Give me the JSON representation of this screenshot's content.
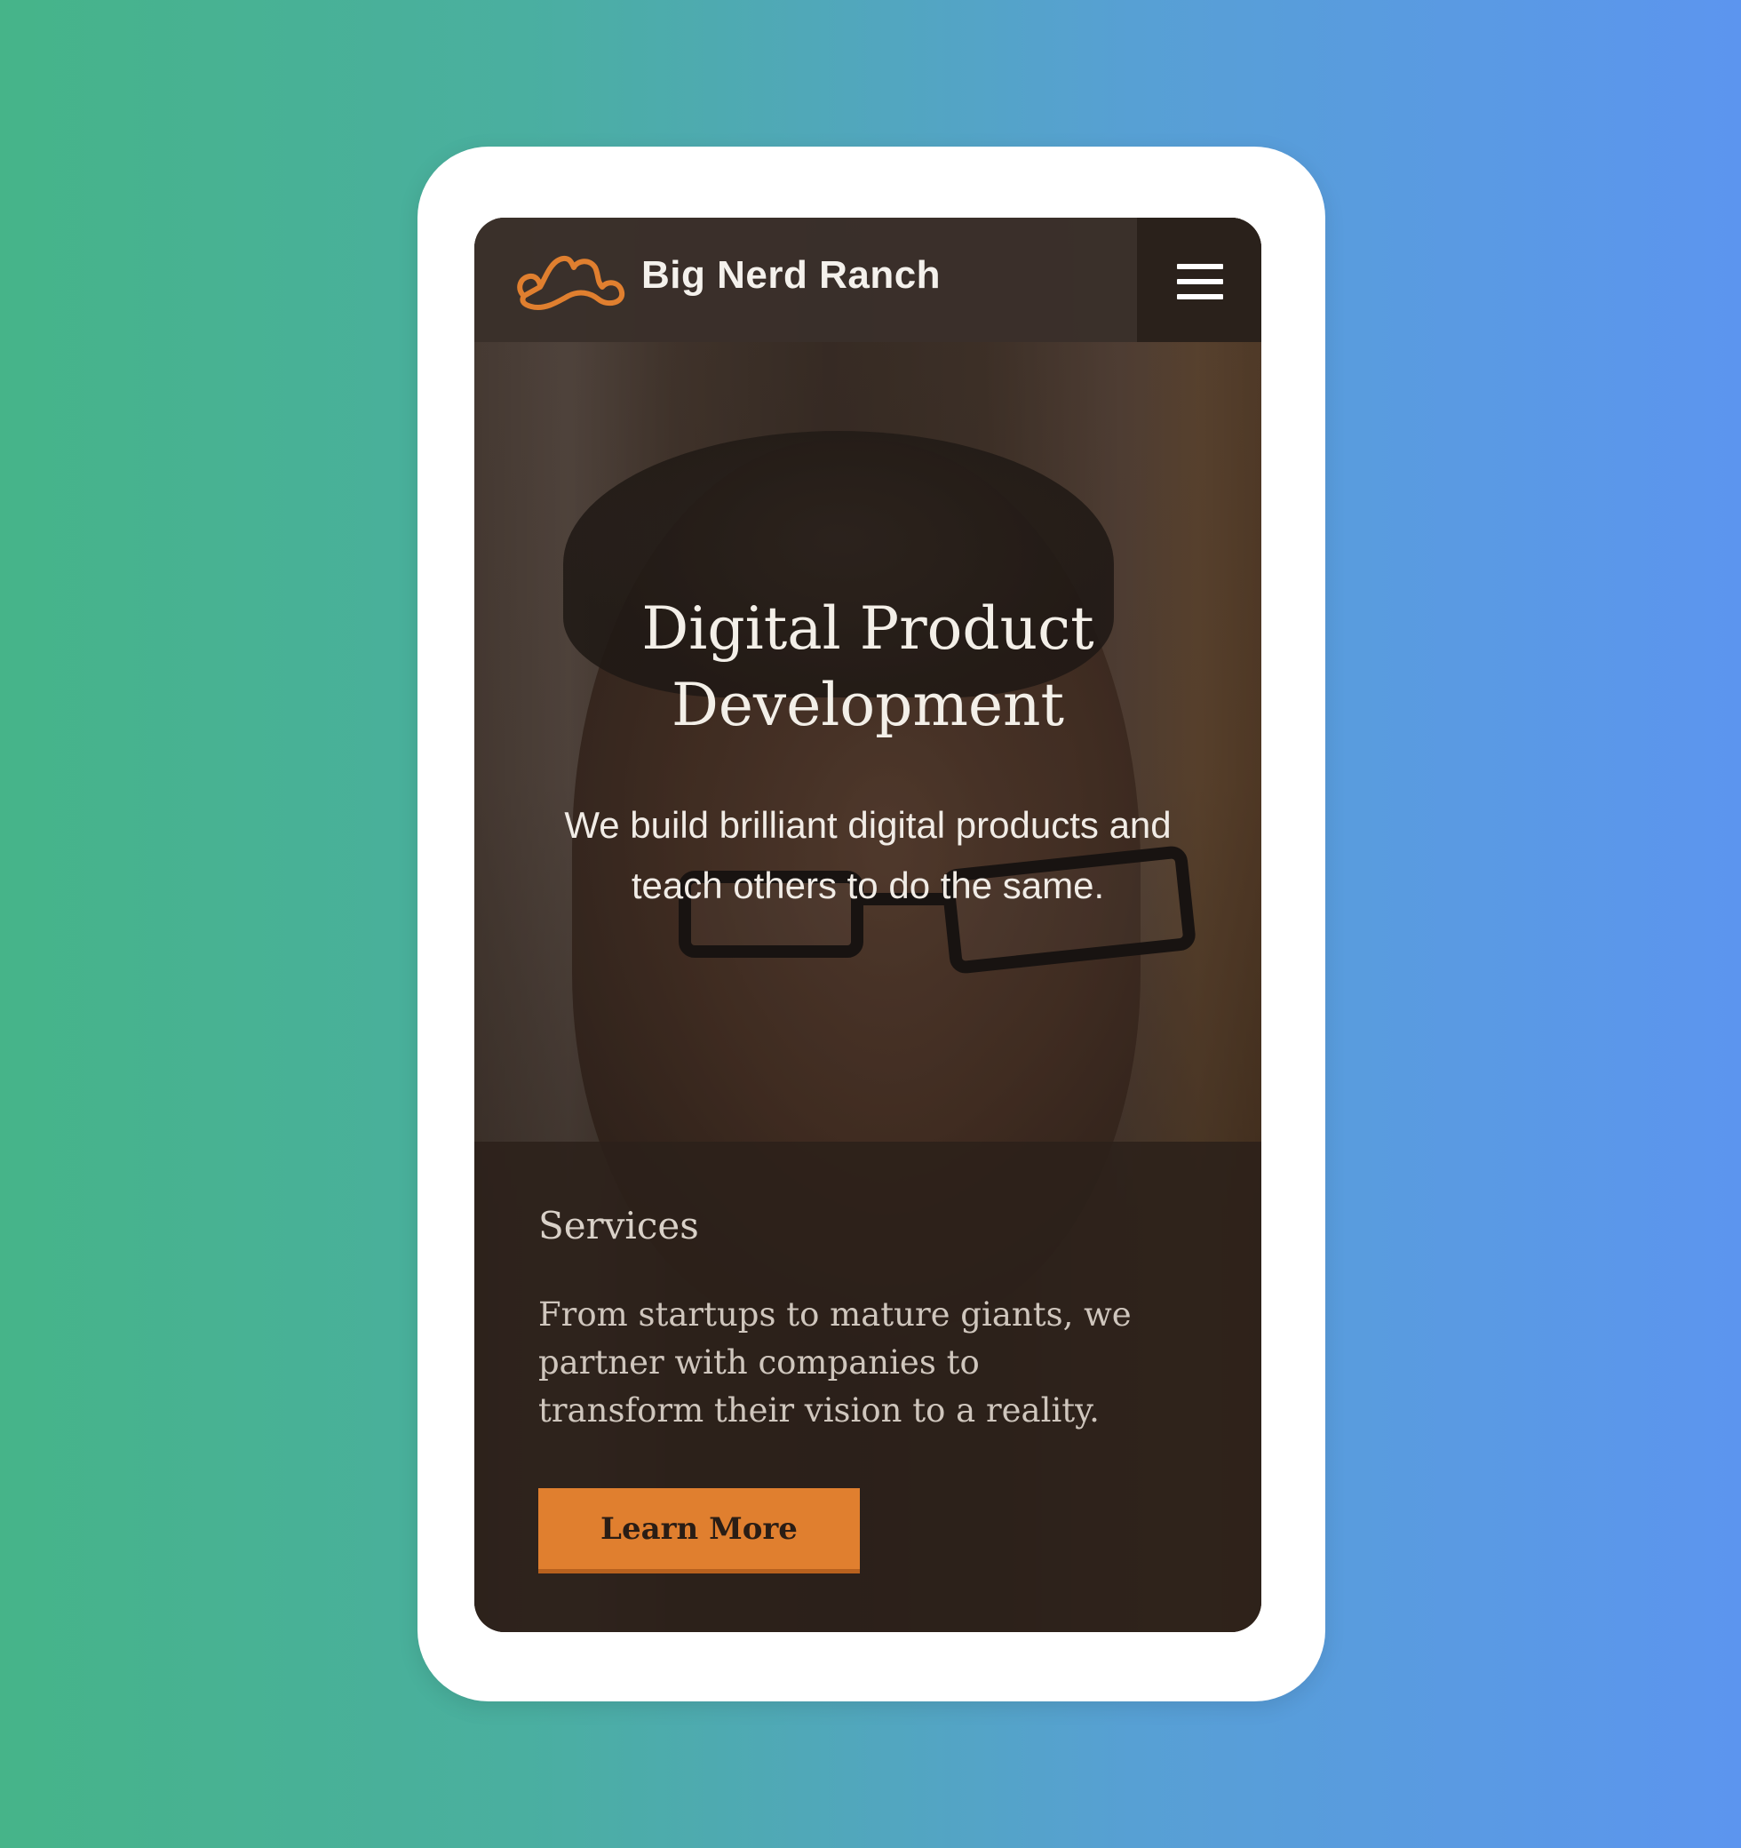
{
  "colors": {
    "background_gradient_start": "#46b489",
    "background_gradient_end": "#5c95ef",
    "accent": "#e07f2f",
    "header_bg": "#3a302a",
    "text_light": "#f3efe8"
  },
  "header": {
    "brand_name": "Big Nerd Ranch",
    "logo_icon": "cowboy-hat-logo-icon",
    "menu_icon": "hamburger-menu-icon"
  },
  "hero": {
    "title_line1": "Digital Product",
    "title_line2": "Development",
    "subtitle_line1": "We build brilliant digital products and",
    "subtitle_line2": "teach others to do the same."
  },
  "services": {
    "heading": "Services",
    "text_line1": "From startups to mature giants, we",
    "text_line2": "partner with companies to",
    "text_line3": "transform their vision to a reality.",
    "cta_label": "Learn More"
  }
}
